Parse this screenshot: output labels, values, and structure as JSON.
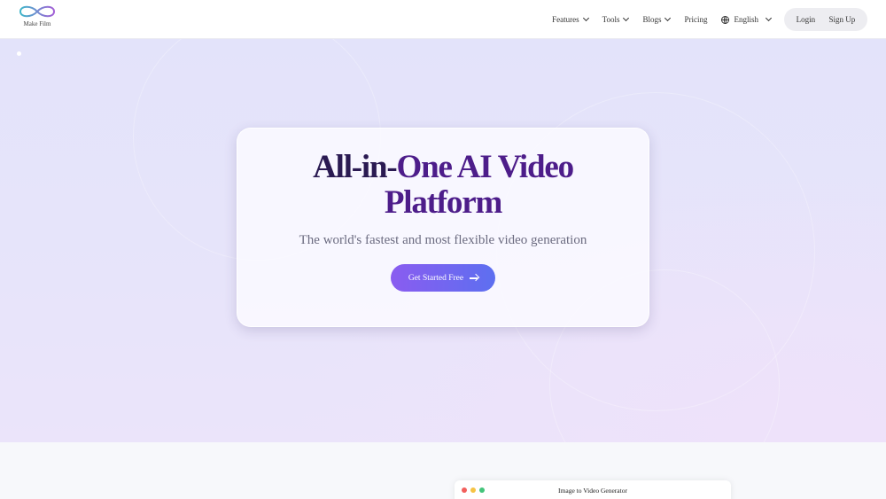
{
  "brand": {
    "name": "Make Film"
  },
  "nav": {
    "features": "Features",
    "tools": "Tools",
    "blogs": "Blogs",
    "pricing": "Pricing",
    "language": "English"
  },
  "auth": {
    "login": "Login",
    "signup": "Sign Up"
  },
  "hero": {
    "title_line1_a": "All-in-",
    "title_line1_b": "One AI Video",
    "title_line2": "Platform",
    "subtitle": "The world's fastest and most flexible video generation",
    "cta": "Get Started Free"
  },
  "preview": {
    "window_title": "Image to Video Generator"
  },
  "colors": {
    "accent_start": "#8a5cf0",
    "accent_end": "#5d6ff0",
    "dot_red": "#f25f5c",
    "dot_yellow": "#f6c344",
    "dot_green": "#43c47a"
  }
}
